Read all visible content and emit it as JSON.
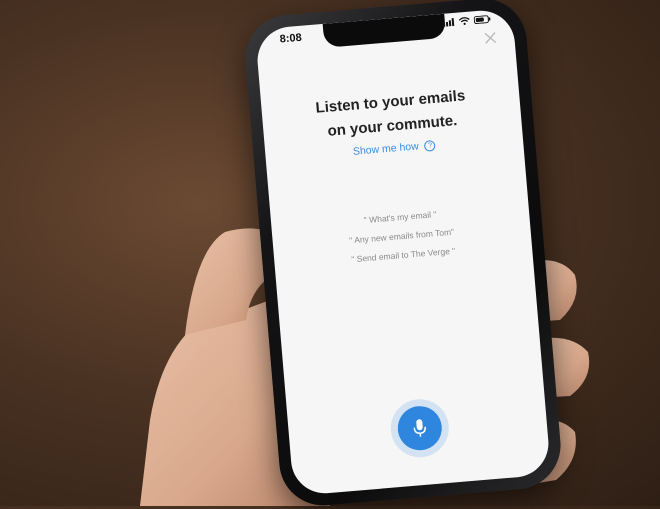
{
  "status": {
    "time": "8:08"
  },
  "headline": {
    "line1": "Listen to your emails",
    "line2": "on your commute."
  },
  "link": {
    "show_me_how": "Show me how",
    "help_glyph": "?"
  },
  "examples": [
    "\" What's my email \"",
    "\" Any new emails from Tom\"",
    "\" Send email to The Verge \""
  ],
  "icons": {
    "close": "close-icon",
    "mic": "microphone-icon",
    "location": "location-arrow-icon",
    "wifi": "wifi-icon",
    "signal": "cellular-signal-icon",
    "battery": "battery-icon"
  },
  "colors": {
    "accent": "#2e86de",
    "link": "#3a8ee0",
    "screen_bg": "#f6f6f6",
    "text": "#222222"
  }
}
